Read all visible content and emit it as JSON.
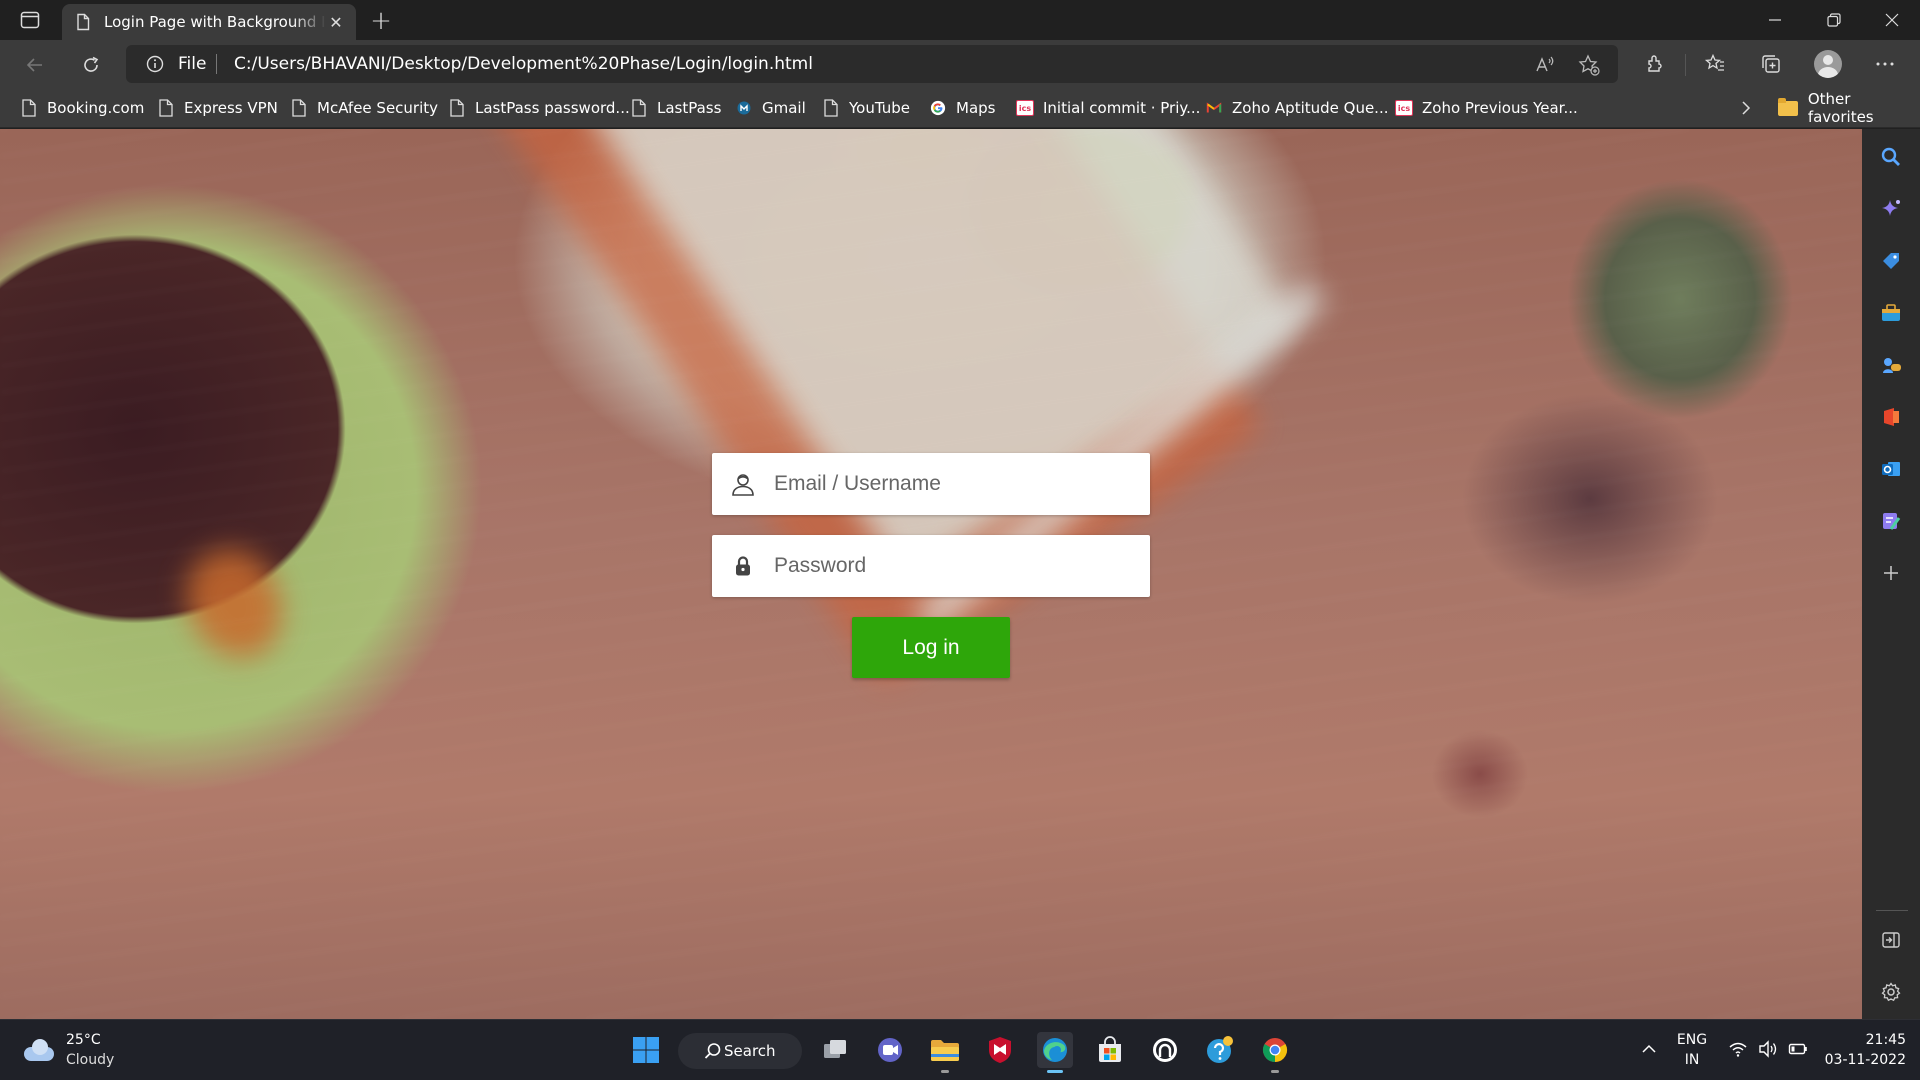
{
  "browser": {
    "tab_title": "Login Page with Background Image",
    "address_scheme": "File",
    "address_url": "C:/Users/BHAVANI/Desktop/Development%20Phase/Login/login.html"
  },
  "favorites": [
    {
      "label": "Booking.com",
      "icon": "page-icon"
    },
    {
      "label": "Express VPN",
      "icon": "page-icon"
    },
    {
      "label": "McAfee Security",
      "icon": "page-icon"
    },
    {
      "label": "LastPass password...",
      "icon": "page-icon"
    },
    {
      "label": "LastPass",
      "icon": "page-icon"
    },
    {
      "label": "Gmail",
      "icon": "gmail-icon"
    },
    {
      "label": "YouTube",
      "icon": "page-icon"
    },
    {
      "label": "Maps",
      "icon": "google-icon"
    },
    {
      "label": "Initial commit · Priy...",
      "icon": "ics-icon"
    },
    {
      "label": "Zoho Aptitude Que...",
      "icon": "zoho-m-icon"
    },
    {
      "label": "Zoho Previous Year...",
      "icon": "ics-icon"
    }
  ],
  "favorites_folder": "Other favorites",
  "login": {
    "username_placeholder": "Email / Username",
    "password_placeholder": "Password",
    "submit_label": "Log in",
    "button_color": "#2ea60a"
  },
  "taskbar": {
    "weather_temp": "25°C",
    "weather_condition": "Cloudy",
    "search_label": "Search",
    "language": "ENG",
    "region": "IN",
    "time": "21:45",
    "date": "03-11-2022"
  }
}
